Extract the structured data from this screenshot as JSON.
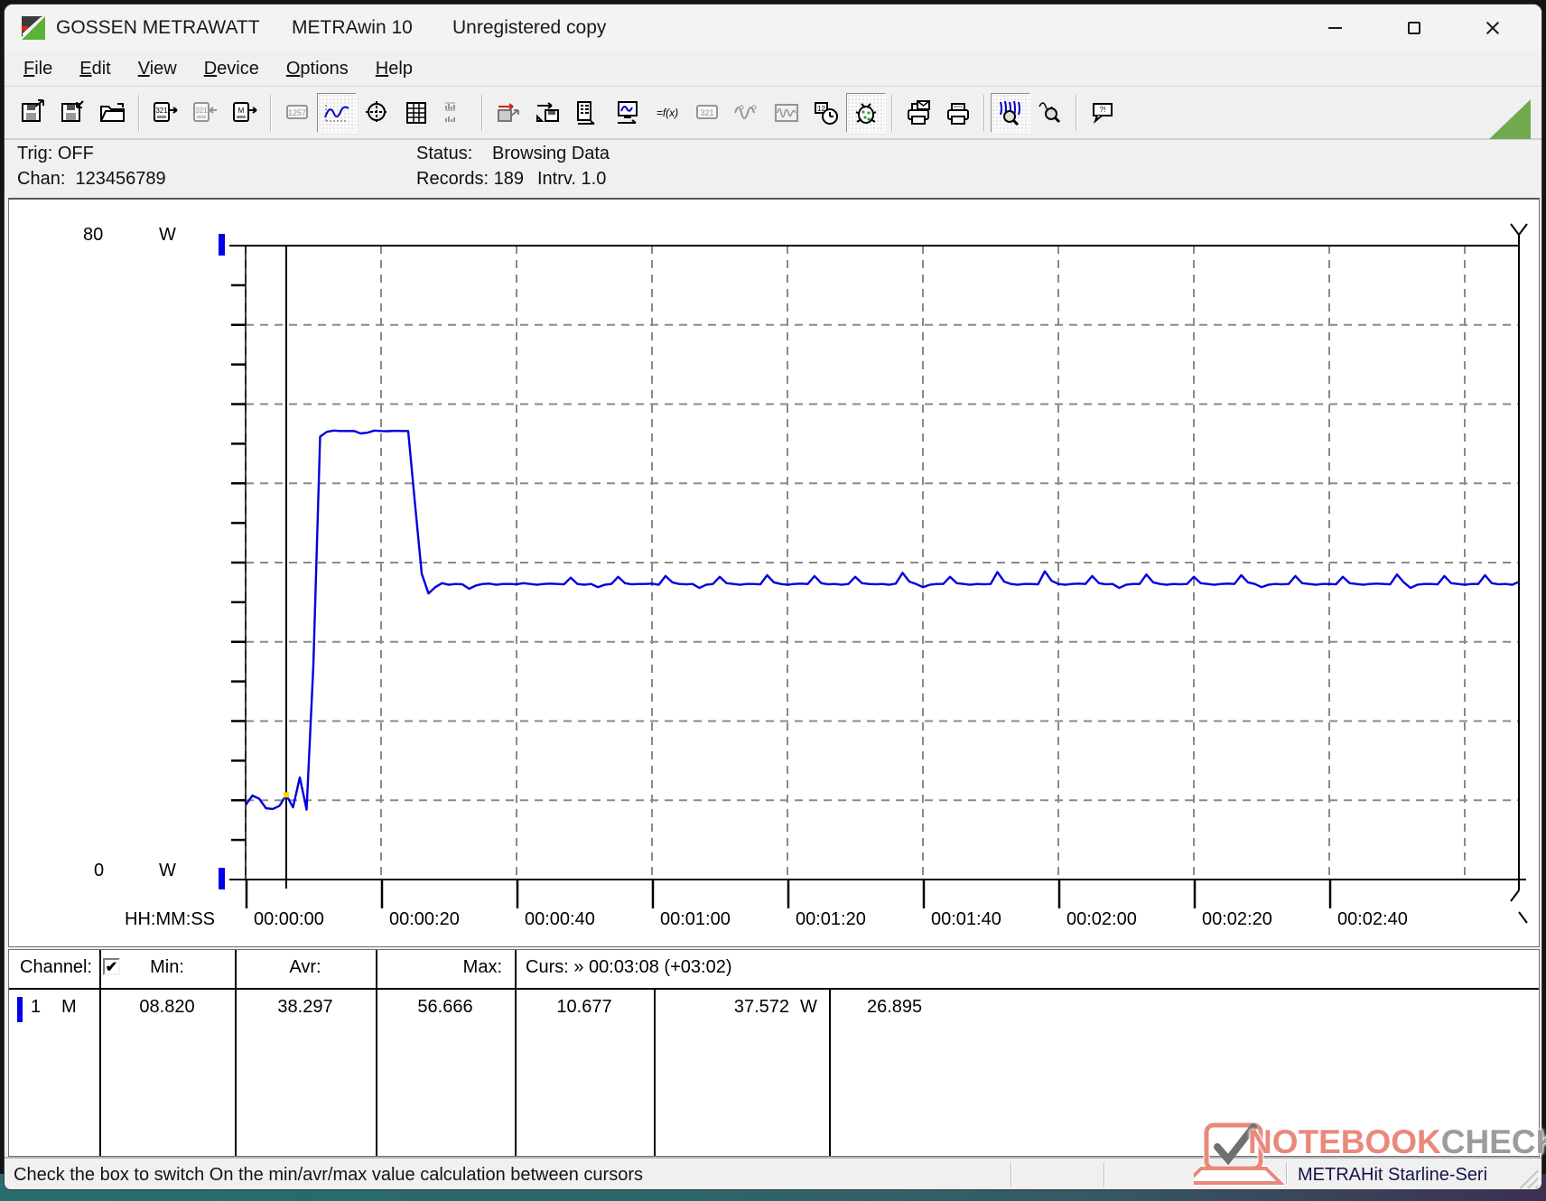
{
  "window": {
    "brand": "GOSSEN METRAWATT",
    "product": "METRAwin 10",
    "license": "Unregistered copy",
    "controls": {
      "minimize": "minimize",
      "maximize": "maximize",
      "close": "close"
    }
  },
  "menu": {
    "items": [
      {
        "id": "file",
        "label": "File"
      },
      {
        "id": "edit",
        "label": "Edit"
      },
      {
        "id": "view",
        "label": "View"
      },
      {
        "id": "device",
        "label": "Device"
      },
      {
        "id": "options",
        "label": "Options"
      },
      {
        "id": "help",
        "label": "Help"
      }
    ]
  },
  "toolbar": {
    "buttons": [
      {
        "name": "save-file-button",
        "glyph": "disk-out",
        "state": "normal"
      },
      {
        "name": "save-as-button",
        "glyph": "disk-in",
        "state": "normal"
      },
      {
        "name": "open-file-button",
        "glyph": "folder",
        "state": "normal"
      },
      {
        "sep": true
      },
      {
        "name": "read-device-button",
        "glyph": "meter-out",
        "state": "normal"
      },
      {
        "name": "send-device-button",
        "glyph": "meter-in",
        "state": "disabled"
      },
      {
        "name": "read-memory-button",
        "glyph": "meter-m",
        "state": "normal"
      },
      {
        "sep": true
      },
      {
        "name": "numeric-display-button",
        "glyph": "panel-1257",
        "state": "disabled"
      },
      {
        "name": "chart-view-button",
        "glyph": "wave",
        "state": "pressed"
      },
      {
        "name": "xy-view-button",
        "glyph": "crosshair",
        "state": "normal"
      },
      {
        "name": "table-view-button",
        "glyph": "table",
        "state": "normal"
      },
      {
        "name": "bar-view-button",
        "glyph": "bars",
        "state": "disabled"
      },
      {
        "sep": true
      },
      {
        "name": "export-transfer-button",
        "glyph": "disk-transfer",
        "state": "normal"
      },
      {
        "name": "device-store-button",
        "glyph": "device-disk",
        "state": "normal"
      },
      {
        "name": "channel-setup-button",
        "glyph": "channels",
        "state": "normal"
      },
      {
        "name": "monitor-button",
        "glyph": "monitor-wave",
        "state": "normal"
      },
      {
        "name": "formula-button",
        "glyph": "fx",
        "state": "normal"
      },
      {
        "name": "numeric-321-button",
        "glyph": "panel-321",
        "state": "disabled"
      },
      {
        "name": "sine-view-button",
        "glyph": "sine",
        "state": "disabled"
      },
      {
        "name": "envelope-view-button",
        "glyph": "damped",
        "state": "disabled"
      },
      {
        "name": "time-setup-button",
        "glyph": "clock",
        "state": "normal"
      },
      {
        "name": "debug-run-button",
        "glyph": "bug",
        "state": "pressed"
      },
      {
        "sep": true
      },
      {
        "name": "print-preview-button",
        "glyph": "print-preview",
        "state": "normal"
      },
      {
        "name": "print-button",
        "glyph": "printer",
        "state": "normal"
      },
      {
        "sep": true
      },
      {
        "name": "zoom-curve-button",
        "glyph": "zoom-wave",
        "state": "pressed"
      },
      {
        "name": "zoom-out-button",
        "glyph": "zoom-out",
        "state": "normal"
      },
      {
        "sep": true
      },
      {
        "name": "hint-button",
        "glyph": "hint",
        "state": "normal"
      }
    ]
  },
  "status_panel": {
    "trig": "Trig: OFF",
    "chan": "Chan:  123456789",
    "status_label": "Status:",
    "status_value": "Browsing Data",
    "records": "Records: 189",
    "interval": "Intrv. 1.0"
  },
  "chart_data": {
    "type": "line",
    "unit": "W",
    "ylim": [
      0,
      80
    ],
    "y_top_label": "80",
    "y_bottom_label": "0",
    "y_unit_label": "W",
    "y_grid_step": 10,
    "y_tick_step": 5,
    "x_axis_label": "HH:MM:SS",
    "x_tick_labels": [
      "00:00:00",
      "00:00:20",
      "00:00:40",
      "00:01:00",
      "00:01:20",
      "00:01:40",
      "00:02:00",
      "00:02:20",
      "00:02:40"
    ],
    "x_tick_seconds": [
      0,
      20,
      40,
      60,
      80,
      100,
      120,
      140,
      160
    ],
    "x_grid_seconds": [
      0,
      20,
      40,
      60,
      80,
      100,
      120,
      140,
      160,
      180
    ],
    "records": 189,
    "interval_s": 1.0,
    "curve_color": "#0000dd",
    "cursor1": {
      "t_s": 6,
      "value": 10.677
    },
    "cursor2": {
      "t_s": 188,
      "value": 37.572,
      "time_label": "00:03:08",
      "delta_label": "+03:02"
    },
    "stats": {
      "min": 8.82,
      "avr": 38.297,
      "max": 56.666,
      "delta": 26.895
    },
    "series": [
      {
        "name": "Channel 1 power (W)",
        "x_start_s": 0,
        "dt_s": 1,
        "values": [
          9.4,
          10.6,
          10.2,
          9.0,
          8.9,
          9.3,
          10.677,
          9.1,
          12.9,
          8.82,
          27.0,
          55.9,
          56.5,
          56.666,
          56.6,
          56.6,
          56.62,
          56.3,
          56.4,
          56.666,
          56.6,
          56.58,
          56.63,
          56.6,
          56.6,
          47.5,
          38.6,
          36.1,
          36.9,
          37.4,
          37.2,
          37.3,
          37.25,
          36.7,
          37.1,
          37.3,
          37.35,
          37.2,
          37.3,
          37.3,
          37.25,
          37.4,
          37.3,
          37.2,
          37.3,
          37.35,
          37.3,
          37.25,
          38.1,
          37.3,
          37.2,
          37.3,
          36.9,
          37.2,
          37.3,
          38.2,
          37.4,
          37.25,
          37.3,
          37.3,
          37.35,
          37.2,
          38.3,
          37.5,
          37.3,
          37.25,
          37.3,
          36.8,
          37.2,
          37.3,
          38.2,
          37.4,
          37.3,
          37.2,
          37.3,
          37.3,
          37.25,
          38.4,
          37.5,
          37.3,
          37.2,
          37.3,
          37.35,
          37.3,
          38.3,
          37.4,
          37.25,
          37.3,
          37.2,
          37.3,
          38.2,
          37.4,
          37.3,
          37.25,
          37.3,
          37.2,
          37.35,
          38.7,
          37.6,
          37.3,
          36.9,
          37.2,
          37.3,
          37.3,
          38.2,
          37.4,
          37.3,
          37.2,
          37.3,
          37.25,
          37.3,
          38.8,
          37.6,
          37.3,
          37.2,
          37.3,
          37.3,
          37.25,
          38.9,
          37.7,
          37.3,
          37.2,
          37.3,
          37.35,
          37.3,
          38.3,
          37.4,
          37.25,
          37.3,
          36.8,
          37.2,
          37.3,
          37.3,
          38.5,
          37.5,
          37.3,
          37.2,
          37.3,
          37.25,
          37.3,
          38.2,
          37.4,
          37.3,
          37.2,
          37.3,
          37.35,
          37.3,
          38.4,
          37.5,
          37.3,
          36.9,
          37.2,
          37.3,
          37.25,
          37.3,
          38.3,
          37.4,
          37.3,
          37.2,
          37.3,
          37.3,
          37.25,
          38.2,
          37.4,
          37.3,
          37.2,
          37.3,
          37.35,
          37.3,
          37.25,
          38.5,
          37.5,
          36.8,
          37.2,
          37.3,
          37.3,
          37.25,
          38.3,
          37.4,
          37.3,
          37.2,
          37.3,
          37.3,
          38.4,
          37.4,
          37.25,
          37.3,
          37.2,
          37.572
        ]
      }
    ]
  },
  "table": {
    "header": {
      "channel": "Channel:",
      "checkbox_checked": true,
      "check_glyph": "✔",
      "min": "Min:",
      "avr": "Avr:",
      "max": "Max:",
      "curs": "Curs: » 00:03:08 (+03:02)"
    },
    "row": {
      "channel_num": "1",
      "channel_mode": "M",
      "min": "08.820",
      "avr": "38.297",
      "max": "56.666",
      "curs1": "10.677",
      "curs2": "37.572",
      "curs2_unit": "W",
      "delta": "26.895"
    }
  },
  "statusbar": {
    "message": "Check the box to switch On the min/avr/max value calculation between cursors",
    "device": "METRAHit Starline-Seri"
  },
  "watermark": {
    "word1": "NOTEBOOK",
    "word2": "CHECK",
    "color1": "#e8897c",
    "color2": "#9c9c9c"
  },
  "colors": {
    "curve": "#0000dd",
    "grid": "#8a8a8a",
    "marker_blue": "#0000e6",
    "cursor_dot": "#ffd400",
    "triangle_green": "#6faa4f",
    "bug_green": "#2e9e3e"
  }
}
